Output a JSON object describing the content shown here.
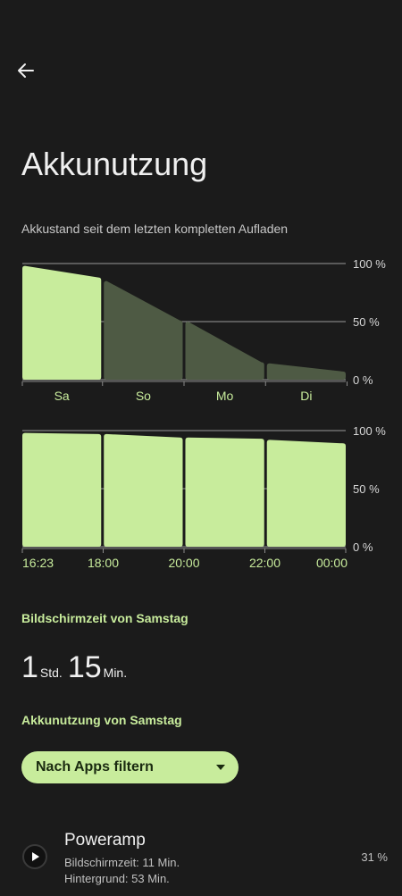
{
  "page": {
    "title": "Akkunutzung",
    "subtitle": "Akkustand seit dem letzten kompletten Aufladen",
    "accent": "#c8ec9c",
    "background": "#1b1b1b",
    "back_icon": "arrow-back-icon"
  },
  "chart_data": [
    {
      "type": "bar",
      "title": "",
      "categories": [
        "Sa",
        "So",
        "Mo",
        "Di"
      ],
      "y_ticks": [
        "100 %",
        "50 %",
        "0 %"
      ],
      "ylim": [
        0,
        100
      ],
      "bars": [
        {
          "start": 98,
          "end": 88,
          "active": true
        },
        {
          "start": 85,
          "end": 51,
          "active": false
        },
        {
          "start": 50,
          "end": 15,
          "active": false
        },
        {
          "start": 14,
          "end": 7,
          "active": false
        }
      ],
      "grid": true
    },
    {
      "type": "bar",
      "title": "",
      "categories": [
        "16:23",
        "18:00",
        "20:00",
        "22:00",
        "00:00"
      ],
      "y_ticks": [
        "100 %",
        "50 %",
        "0 %"
      ],
      "ylim": [
        0,
        100
      ],
      "bars": [
        {
          "start": 98,
          "end": 97,
          "active": true
        },
        {
          "start": 97,
          "end": 94,
          "active": true
        },
        {
          "start": 94,
          "end": 93,
          "active": true
        },
        {
          "start": 92,
          "end": 89,
          "active": true
        }
      ],
      "grid": true
    }
  ],
  "screen_time": {
    "title": "Bildschirmzeit von Samstag",
    "hours": "1",
    "hours_unit": "Std.",
    "minutes": "15",
    "minutes_unit": "Min."
  },
  "usage": {
    "title": "Akkunutzung von Samstag",
    "filter_label": "Nach Apps filtern",
    "filter_icon": "dropdown-arrow-icon"
  },
  "apps": [
    {
      "name": "Poweramp",
      "icon": "play-icon",
      "screen_time": "Bildschirmzeit: 11 Min.",
      "background": "Hintergrund: 53 Min.",
      "percent": "31 %"
    }
  ]
}
